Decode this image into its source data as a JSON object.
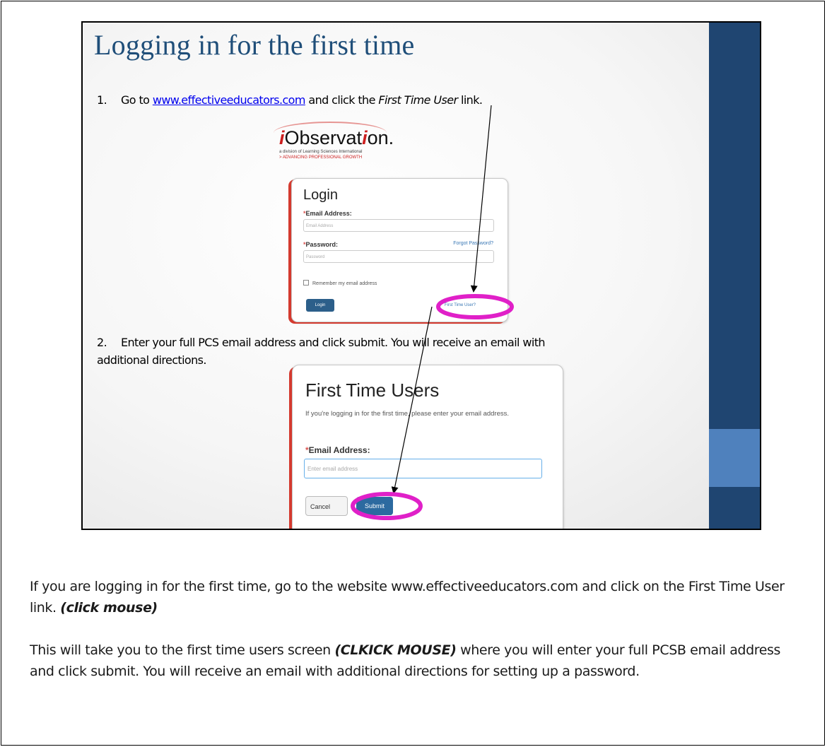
{
  "slide": {
    "title": "Logging in for the first time",
    "step1": {
      "number": "1.",
      "text_before": "Go to ",
      "link": "www.effectiveeducators.com",
      "text_middle": " and click the ",
      "emphasis": "First Time User",
      "text_after": " link."
    },
    "step2": {
      "number": "2.",
      "line1": "Enter your full PCS email address and click submit. You will receive an email with",
      "line2": "additional directions."
    },
    "logo": {
      "prefix": "i",
      "word_a": "Observat",
      "word_i": "i",
      "word_b": "on.",
      "subtitle": "a division of Learning Sciences International",
      "tagline": "> ADVANCING PROFESSIONAL GROWTH"
    },
    "login_form": {
      "title": "Login",
      "required_mark": "*",
      "email_label": "Email Address:",
      "email_placeholder": "Email Address",
      "password_label": "Password:",
      "password_placeholder": "Password",
      "forgot_link": "Forgot Password?",
      "remember_label": "Remember my email address",
      "login_button": "Login",
      "first_time_link": "First Time User?"
    },
    "first_time_form": {
      "title": "First Time Users",
      "description": "If you're logging in for the first time, please enter your email address.",
      "required_mark": "*",
      "email_label": "Email Address:",
      "email_placeholder": "Enter email address",
      "cancel_button": "Cancel",
      "submit_button": "Submit"
    },
    "colors": {
      "title": "#1f4e79",
      "sidebar": "#1f4571",
      "sidebar_accent": "#4f81bd",
      "highlight": "#e020c8"
    }
  },
  "notes": {
    "p1_text": "If you are logging in for the first time, go to the website www.effectiveeducators.com and click on the First Time User link. ",
    "p1_em": "(click mouse)",
    "p2_before": "This will take you to the first time users screen ",
    "p2_em": "(CLKICK MOUSE)",
    "p2_after": " where you will enter your full PCSB email address and click submit. You will receive an email with additional directions for setting up a password."
  }
}
